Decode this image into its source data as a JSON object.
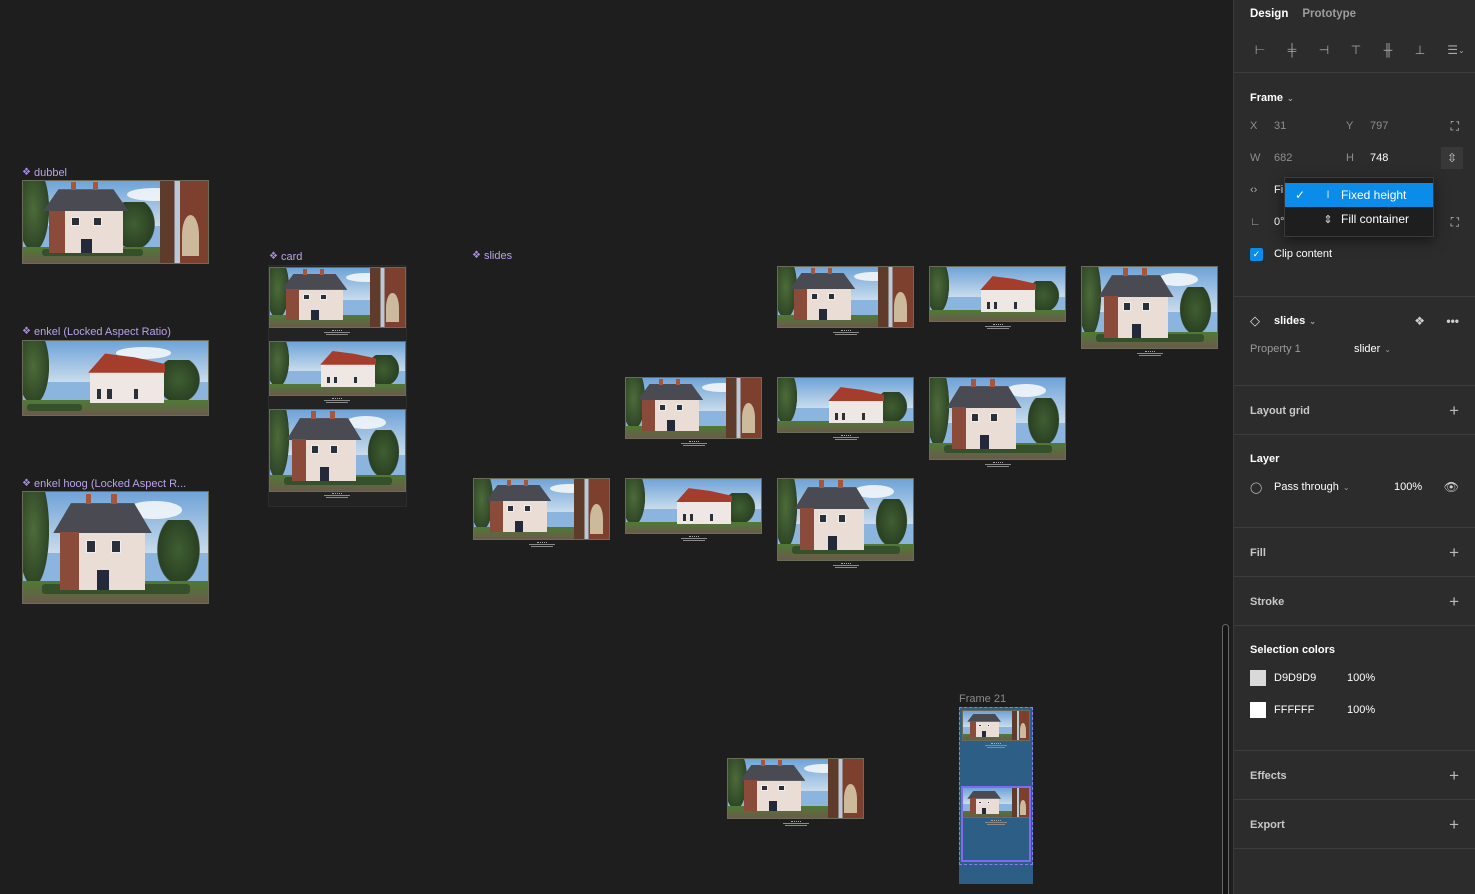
{
  "canvas": {
    "components": [
      {
        "label": "dubbel",
        "icon": "component-icon"
      },
      {
        "label": "enkel (Locked Aspect Ratio)",
        "icon": "component-icon"
      },
      {
        "label": "enkel hoog (Locked Aspect R...",
        "icon": "component-icon"
      },
      {
        "label": "card",
        "icon": "component-icon"
      },
      {
        "label": "slides",
        "icon": "component-icon"
      }
    ],
    "frame21_label": "Frame 21"
  },
  "panel": {
    "tabs": [
      {
        "label": "Design",
        "active": true
      },
      {
        "label": "Prototype",
        "active": false
      }
    ],
    "alignment_icons": [
      "align-left-icon",
      "align-horizontal-center-icon",
      "align-right-icon",
      "align-top-icon",
      "align-vertical-center-icon",
      "align-bottom-icon",
      "distribute-icon"
    ],
    "frame": {
      "title": "Frame",
      "x_label": "X",
      "x": "31",
      "y_label": "Y",
      "y": "797",
      "w_label": "W",
      "w": "682",
      "h_label": "H",
      "h": "748",
      "resize_partial": "Fi",
      "rotation_partial": "0°",
      "clip_content_label": "Clip content",
      "clip_content_checked": true,
      "height_menu": [
        {
          "label": "Fixed height",
          "selected": true,
          "glyph": "I"
        },
        {
          "label": "Fill container",
          "selected": false,
          "glyph": "⇕"
        }
      ]
    },
    "instance": {
      "name": "slides",
      "property_label": "Property 1",
      "property_value": "slider"
    },
    "layout_grid": {
      "title": "Layout grid"
    },
    "layer": {
      "title": "Layer",
      "blend": "Pass through",
      "opacity": "100%"
    },
    "fill": {
      "title": "Fill"
    },
    "stroke": {
      "title": "Stroke"
    },
    "selection_colors": {
      "title": "Selection colors",
      "items": [
        {
          "hex": "D9D9D9",
          "opacity": "100%",
          "color": "#D9D9D9"
        },
        {
          "hex": "FFFFFF",
          "opacity": "100%",
          "color": "#FFFFFF"
        }
      ]
    },
    "effects": {
      "title": "Effects"
    },
    "export": {
      "title": "Export"
    }
  },
  "colors": {
    "accent": "#0c8ce9",
    "component": "#b9a3e8",
    "frame_fill": "#2c5e86",
    "selection": "#7b6cf0"
  }
}
